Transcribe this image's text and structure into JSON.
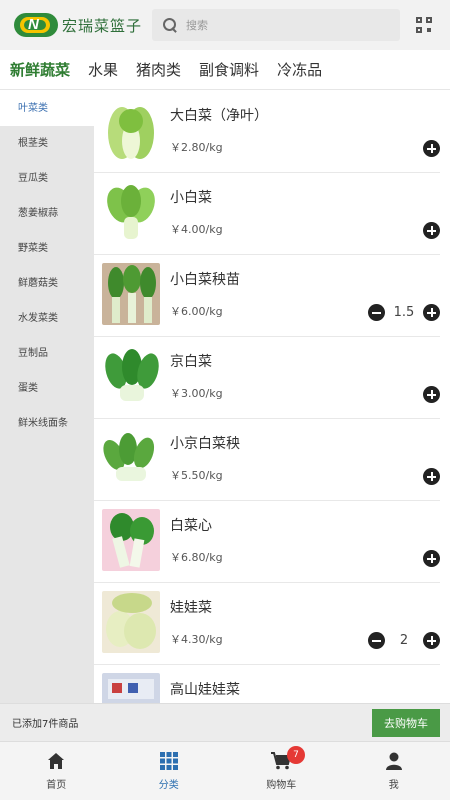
{
  "header": {
    "logo_text": "宏瑞菜篮子",
    "logo_letter": "N",
    "search_placeholder": "搜索"
  },
  "tabs": [
    {
      "label": "新鲜蔬菜",
      "active": true
    },
    {
      "label": "水果"
    },
    {
      "label": "猪肉类"
    },
    {
      "label": "副食调料"
    },
    {
      "label": "冷冻品"
    }
  ],
  "sidebar": [
    {
      "label": "叶菜类",
      "active": true
    },
    {
      "label": "根茎类"
    },
    {
      "label": "豆瓜类"
    },
    {
      "label": "葱姜椒蒜"
    },
    {
      "label": "野菜类"
    },
    {
      "label": "鲜蘑菇类"
    },
    {
      "label": "水发菜类"
    },
    {
      "label": "豆制品"
    },
    {
      "label": "蛋类"
    },
    {
      "label": "鲜米线面条"
    }
  ],
  "products": [
    {
      "name": "大白菜（净叶）",
      "price": "￥2.80/kg",
      "qty": ""
    },
    {
      "name": "小白菜",
      "price": "￥4.00/kg",
      "qty": ""
    },
    {
      "name": "小白菜秧苗",
      "price": "￥6.00/kg",
      "qty": "1.5"
    },
    {
      "name": "京白菜",
      "price": "￥3.00/kg",
      "qty": ""
    },
    {
      "name": "小京白菜秧",
      "price": "￥5.50/kg",
      "qty": ""
    },
    {
      "name": "白菜心",
      "price": "￥6.80/kg",
      "qty": ""
    },
    {
      "name": "娃娃菜",
      "price": "￥4.30/kg",
      "qty": "2"
    },
    {
      "name": "高山娃娃菜",
      "price": "",
      "qty": ""
    }
  ],
  "cart": {
    "info": "已添加7件商品",
    "button": "去购物车"
  },
  "bottom_nav": [
    {
      "label": "首页",
      "icon": "home-icon"
    },
    {
      "label": "分类",
      "icon": "grid-icon",
      "active": true
    },
    {
      "label": "购物车",
      "icon": "cart-icon",
      "badge": "7"
    },
    {
      "label": "我",
      "icon": "user-icon"
    }
  ],
  "colors": {
    "accent_green": "#4a9a46",
    "tab_active": "#2f7d32",
    "nav_active": "#2c6fb0",
    "badge": "#e53935"
  }
}
